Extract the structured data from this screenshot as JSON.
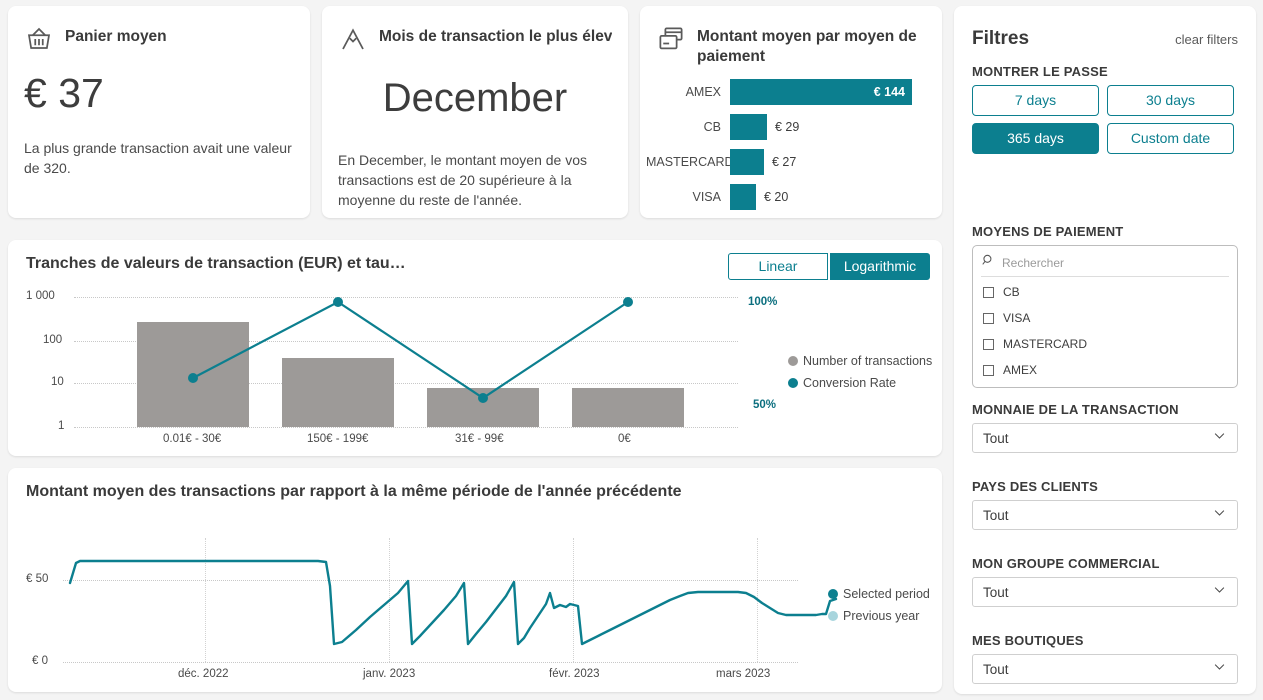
{
  "kpi_cards": [
    {
      "icon": "basket-icon",
      "title": "Panier moyen",
      "value": "€ 37",
      "subtitle": "La plus grande transaction avait une valeur de 320."
    },
    {
      "icon": "peak-icon",
      "title": "Mois de transaction le plus élevé",
      "value": "December",
      "subtitle": "En December, le montant moyen de vos transactions est de 20 supérieure à la moyenne du reste de l'année."
    }
  ],
  "payment_card": {
    "icon": "credit-cards-icon",
    "title": "Montant moyen par moyen de paiement",
    "rows": [
      {
        "label": "AMEX",
        "value": "€ 144",
        "amount": 144,
        "inside": true
      },
      {
        "label": "CB",
        "value": "€ 29",
        "amount": 29,
        "inside": false
      },
      {
        "label": "MASTERCARD",
        "value": "€ 27",
        "amount": 27,
        "inside": false
      },
      {
        "label": "VISA",
        "value": "€ 20",
        "amount": 20,
        "inside": false
      }
    ]
  },
  "brackets_chart": {
    "title": "Tranches de valeurs de transaction (EUR) et tau…",
    "scale_buttons": [
      {
        "label": "Linear",
        "active": false
      },
      {
        "label": "Logarithmic",
        "active": true
      }
    ],
    "legend": [
      {
        "label": "Number of transactions",
        "color": "#9d9a98"
      },
      {
        "label": "Conversion Rate",
        "color": "#0c7f8f"
      }
    ],
    "chart_data": {
      "type": "bar",
      "title": "Tranches de valeurs de transaction (EUR) et taux de conversion",
      "categories": [
        "0.01€ - 30€",
        "150€ - 199€",
        "31€ - 99€",
        "0€"
      ],
      "xlabel": "",
      "ylabel": "Number of transactions",
      "yscale": "log",
      "yticks": [
        "1",
        "10",
        "100",
        "1 000"
      ],
      "ylim": [
        1,
        1000
      ],
      "grid": true,
      "y2label": "Conversion Rate",
      "y2ticks": [
        "50%",
        "100%"
      ],
      "y2lim": [
        50,
        100
      ],
      "legend_position": "right",
      "series": [
        {
          "name": "Number of transactions",
          "type": "bar",
          "color": "#9d9a98",
          "values": [
            250,
            50,
            8,
            8
          ]
        },
        {
          "name": "Conversion Rate",
          "type": "line",
          "color": "#0c7f8f",
          "values": [
            63,
            100,
            50,
            100
          ]
        }
      ]
    }
  },
  "trend_chart": {
    "title": "Montant moyen des transactions par rapport à la même période de l'année précédente",
    "legend": [
      {
        "label": "Selected period",
        "color": "#0c7f8f"
      },
      {
        "label": "Previous year",
        "color": "#a8d5dd"
      }
    ],
    "chart_data": {
      "type": "line",
      "title": "Montant moyen des transactions par rapport à la même période de l'année précédente",
      "xlabel": "",
      "ylabel": "",
      "yticks": [
        "€ 0",
        "€ 50"
      ],
      "ylim": [
        0,
        75
      ],
      "xticks": [
        "déc. 2022",
        "janv. 2023",
        "févr. 2023",
        "mars 2023"
      ],
      "grid": true,
      "legend_position": "right",
      "series": [
        {
          "name": "Selected period",
          "color": "#0c7f8f",
          "values": [
            48,
            62,
            62,
            62,
            62,
            62,
            62,
            62,
            62,
            62,
            62,
            62,
            62,
            62,
            62,
            61,
            5,
            12,
            20,
            27,
            35,
            43,
            51,
            7,
            16,
            26,
            35,
            45,
            54,
            9,
            18,
            28,
            38,
            48,
            57,
            14,
            24,
            35,
            46,
            56,
            50,
            42,
            46,
            44,
            45,
            43,
            8,
            11,
            14,
            17,
            20,
            23,
            26,
            29,
            32,
            35,
            38,
            41,
            43,
            44,
            44,
            44,
            44,
            44,
            44,
            43,
            41,
            38,
            35,
            33,
            32,
            32,
            32,
            32,
            33,
            33,
            33,
            40,
            42
          ]
        },
        {
          "name": "Previous year",
          "color": "#a8d5dd",
          "values": []
        }
      ]
    }
  },
  "filters": {
    "title": "Filtres",
    "clear_label": "clear filters",
    "period": {
      "label": "MONTRER LE PASSE",
      "options": [
        {
          "label": "7 days",
          "active": false
        },
        {
          "label": "30 days",
          "active": false
        },
        {
          "label": "365 days",
          "active": true
        },
        {
          "label": "Custom date",
          "active": false
        }
      ]
    },
    "payment_methods": {
      "label": "MOYENS DE PAIEMENT",
      "search_placeholder": "Rechercher",
      "search_value": "",
      "items": [
        {
          "label": "CB",
          "checked": false
        },
        {
          "label": "VISA",
          "checked": false
        },
        {
          "label": "MASTERCARD",
          "checked": false
        },
        {
          "label": "AMEX",
          "checked": false
        }
      ]
    },
    "selects": [
      {
        "label": "MONNAIE DE LA TRANSACTION",
        "value": "Tout"
      },
      {
        "label": "PAYS DES CLIENTS",
        "value": "Tout"
      },
      {
        "label": "MON GROUPE COMMERCIAL",
        "value": "Tout"
      },
      {
        "label": "MES BOUTIQUES",
        "value": "Tout"
      }
    ]
  },
  "colors": {
    "accent": "#0c7f8f",
    "bar_gray": "#9d9a98",
    "background": "#f4f4f4",
    "card": "#ffffff"
  }
}
